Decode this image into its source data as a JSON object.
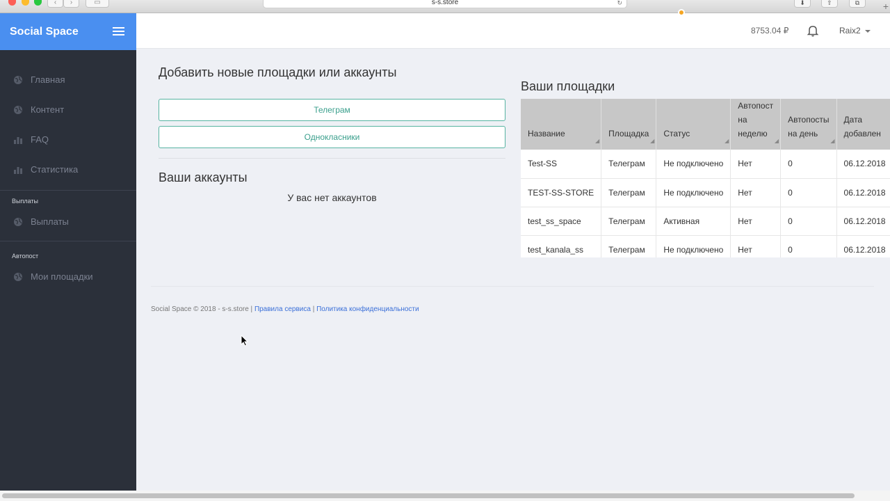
{
  "browser": {
    "url": "s-s.store"
  },
  "sidebar": {
    "brand": "Social Space",
    "items": [
      {
        "label": "Главная",
        "icon": "globe-icon"
      },
      {
        "label": "Контент",
        "icon": "globe-icon"
      },
      {
        "label": "FAQ",
        "icon": "bar-chart-icon"
      },
      {
        "label": "Статистика",
        "icon": "bar-chart-icon"
      }
    ],
    "sections": [
      {
        "title": "Выплаты",
        "items": [
          {
            "label": "Выплаты",
            "icon": "globe-icon"
          }
        ]
      },
      {
        "title": "Автопост",
        "items": [
          {
            "label": "Мои площадки",
            "icon": "globe-icon"
          }
        ]
      }
    ]
  },
  "header": {
    "balance": "8753.04 ₽",
    "username": "Raix2",
    "notification_color": "#f5a623"
  },
  "add_section": {
    "title": "Добавить новые площадки или аккаунты",
    "buttons": [
      "Телеграм",
      "Однокласники"
    ]
  },
  "accounts": {
    "title": "Ваши аккаунты",
    "empty_text": "У вас нет аккаунтов"
  },
  "places": {
    "title": "Ваши площадки",
    "columns": [
      "Название",
      "Площадка",
      "Статус",
      "Автопост на неделю",
      "Автопосты на день",
      "Дата добавлен"
    ],
    "rows": [
      [
        "Test-SS",
        "Телеграм",
        "Не подключено",
        "Нет",
        "0",
        "06.12.2018"
      ],
      [
        "TEST-SS-STORE",
        "Телеграм",
        "Не подключено",
        "Нет",
        "0",
        "06.12.2018"
      ],
      [
        "test_ss_space",
        "Телеграм",
        "Активная",
        "Нет",
        "0",
        "06.12.2018"
      ],
      [
        "test_kanala_ss",
        "Телеграм",
        "Не подключено",
        "Нет",
        "0",
        "06.12.2018"
      ]
    ]
  },
  "footer": {
    "copyright": "Social Space © 2018 - s-s.store |",
    "link_rules": "Правила сервиса",
    "separator": "|",
    "link_privacy": "Политика конфиденциальности"
  },
  "colors": {
    "brand": "#4a8ff0",
    "sidebar_bg": "#2b303a",
    "accent_outline": "#56b3a1",
    "link": "#3a6fd8"
  }
}
